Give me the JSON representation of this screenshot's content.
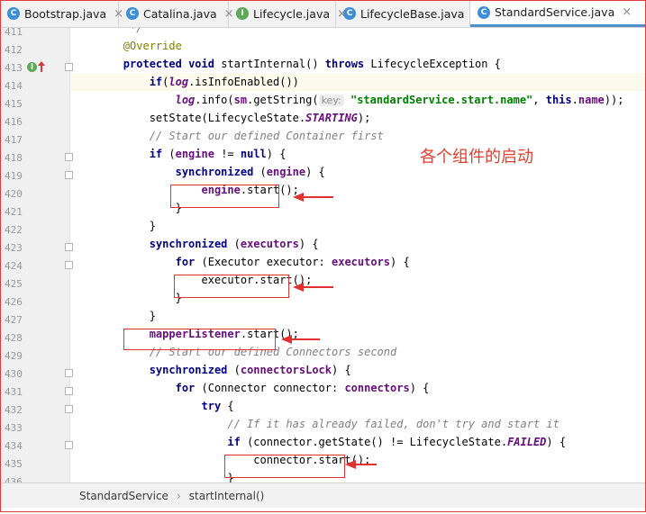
{
  "tabs": [
    {
      "label": "Bootstrap.java",
      "icon": "C",
      "icon_color": "#3f8fd8",
      "active": false
    },
    {
      "label": "Catalina.java",
      "icon": "C",
      "icon_color": "#3f8fd8",
      "active": false
    },
    {
      "label": "Lifecycle.java",
      "icon": "I",
      "icon_color": "#5fa85a",
      "active": false
    },
    {
      "label": "LifecycleBase.java",
      "icon": "C",
      "icon_color": "#3f8fd8",
      "active": false
    },
    {
      "label": "StandardService.java",
      "icon": "C",
      "icon_color": "#3f8fd8",
      "active": true
    }
  ],
  "gutter": {
    "line_numbers": [
      "411",
      "412",
      "413",
      "414",
      "415",
      "416",
      "417",
      "418",
      "419",
      "420",
      "421",
      "422",
      "423",
      "424",
      "425",
      "426",
      "427",
      "428",
      "429",
      "430",
      "431",
      "432",
      "433",
      "434",
      "435",
      "436"
    ],
    "markers": {
      "implements_icon": "I",
      "override_icon": "up-arrow"
    }
  },
  "code": {
    "lines": [
      [
        {
          "t": "         */",
          "c": "cm"
        }
      ],
      [
        {
          "t": "        @Override",
          "c": "an"
        }
      ],
      [
        {
          "t": "        ",
          "c": ""
        },
        {
          "t": "protected",
          "c": "kw"
        },
        {
          "t": " ",
          "c": ""
        },
        {
          "t": "void",
          "c": "kw"
        },
        {
          "t": " startInternal() ",
          "c": ""
        },
        {
          "t": "throws",
          "c": "kw"
        },
        {
          "t": " LifecycleException {",
          "c": ""
        }
      ],
      [
        {
          "t": "            ",
          "c": ""
        },
        {
          "t": "if",
          "c": "kw"
        },
        {
          "t": "(",
          "c": ""
        },
        {
          "t": "log",
          "c": "fd it"
        },
        {
          "t": ".isInfoEnabled())",
          "c": ""
        }
      ],
      [
        {
          "t": "                ",
          "c": ""
        },
        {
          "t": "log",
          "c": "fd it"
        },
        {
          "t": ".info(",
          "c": ""
        },
        {
          "t": "sm",
          "c": "fd"
        },
        {
          "t": ".getString(",
          "c": ""
        },
        {
          "t": "key:",
          "c": "hint"
        },
        {
          "t": " ",
          "c": ""
        },
        {
          "t": "\"standardService.start.name\"",
          "c": "str"
        },
        {
          "t": ", ",
          "c": ""
        },
        {
          "t": "this",
          "c": "kw"
        },
        {
          "t": ".",
          "c": ""
        },
        {
          "t": "name",
          "c": "fd"
        },
        {
          "t": "));",
          "c": ""
        }
      ],
      [
        {
          "t": "            setState(LifecycleState.",
          "c": ""
        },
        {
          "t": "STARTING",
          "c": "fd it"
        },
        {
          "t": ");",
          "c": ""
        }
      ],
      [
        {
          "t": "            // Start our defined Container first",
          "c": "cm"
        }
      ],
      [
        {
          "t": "            ",
          "c": ""
        },
        {
          "t": "if",
          "c": "kw"
        },
        {
          "t": " (",
          "c": ""
        },
        {
          "t": "engine",
          "c": "fd"
        },
        {
          "t": " != ",
          "c": ""
        },
        {
          "t": "null",
          "c": "kw"
        },
        {
          "t": ") {",
          "c": ""
        }
      ],
      [
        {
          "t": "                ",
          "c": ""
        },
        {
          "t": "synchronized",
          "c": "kw"
        },
        {
          "t": " (",
          "c": ""
        },
        {
          "t": "engine",
          "c": "fd"
        },
        {
          "t": ") {",
          "c": ""
        }
      ],
      [
        {
          "t": "                    ",
          "c": ""
        },
        {
          "t": "engine",
          "c": "fd"
        },
        {
          "t": ".start();",
          "c": ""
        }
      ],
      [
        {
          "t": "                }",
          "c": ""
        }
      ],
      [
        {
          "t": "            }",
          "c": ""
        }
      ],
      [
        {
          "t": "            ",
          "c": ""
        },
        {
          "t": "synchronized",
          "c": "kw"
        },
        {
          "t": " (",
          "c": ""
        },
        {
          "t": "executors",
          "c": "fd"
        },
        {
          "t": ") {",
          "c": ""
        }
      ],
      [
        {
          "t": "                ",
          "c": ""
        },
        {
          "t": "for",
          "c": "kw"
        },
        {
          "t": " (Executor executor: ",
          "c": ""
        },
        {
          "t": "executors",
          "c": "fd"
        },
        {
          "t": ") {",
          "c": ""
        }
      ],
      [
        {
          "t": "                    executor.start();",
          "c": ""
        }
      ],
      [
        {
          "t": "                }",
          "c": ""
        }
      ],
      [
        {
          "t": "            }",
          "c": ""
        }
      ],
      [
        {
          "t": "            ",
          "c": ""
        },
        {
          "t": "mapperListener",
          "c": "fd"
        },
        {
          "t": ".start();",
          "c": ""
        }
      ],
      [
        {
          "t": "            // Start our defined Connectors second",
          "c": "cm"
        }
      ],
      [
        {
          "t": "            ",
          "c": ""
        },
        {
          "t": "synchronized",
          "c": "kw"
        },
        {
          "t": " (",
          "c": ""
        },
        {
          "t": "connectorsLock",
          "c": "fd"
        },
        {
          "t": ") {",
          "c": ""
        }
      ],
      [
        {
          "t": "                ",
          "c": ""
        },
        {
          "t": "for",
          "c": "kw"
        },
        {
          "t": " (Connector connector: ",
          "c": ""
        },
        {
          "t": "connectors",
          "c": "fd"
        },
        {
          "t": ") {",
          "c": ""
        }
      ],
      [
        {
          "t": "                    ",
          "c": ""
        },
        {
          "t": "try",
          "c": "kw"
        },
        {
          "t": " {",
          "c": ""
        }
      ],
      [
        {
          "t": "                        // If it has already failed, don't try and start it",
          "c": "cm"
        }
      ],
      [
        {
          "t": "                        ",
          "c": ""
        },
        {
          "t": "if",
          "c": "kw"
        },
        {
          "t": " (connector.getState() != LifecycleState.",
          "c": ""
        },
        {
          "t": "FAILED",
          "c": "fd it"
        },
        {
          "t": ") {",
          "c": ""
        }
      ],
      [
        {
          "t": "                            connector.start();",
          "c": ""
        }
      ],
      [
        {
          "t": "                        }",
          "c": ""
        }
      ]
    ]
  },
  "annotation": {
    "text": "各个组件的启动"
  },
  "breadcrumb": {
    "items": [
      "StandardService",
      "startInternal()"
    ],
    "separator": "›"
  },
  "colors": {
    "annotation_red": "#e23d2d",
    "keyword": "#000080",
    "field": "#660e7a",
    "string": "#008000",
    "comment": "#808080",
    "annotation": "#808000"
  }
}
